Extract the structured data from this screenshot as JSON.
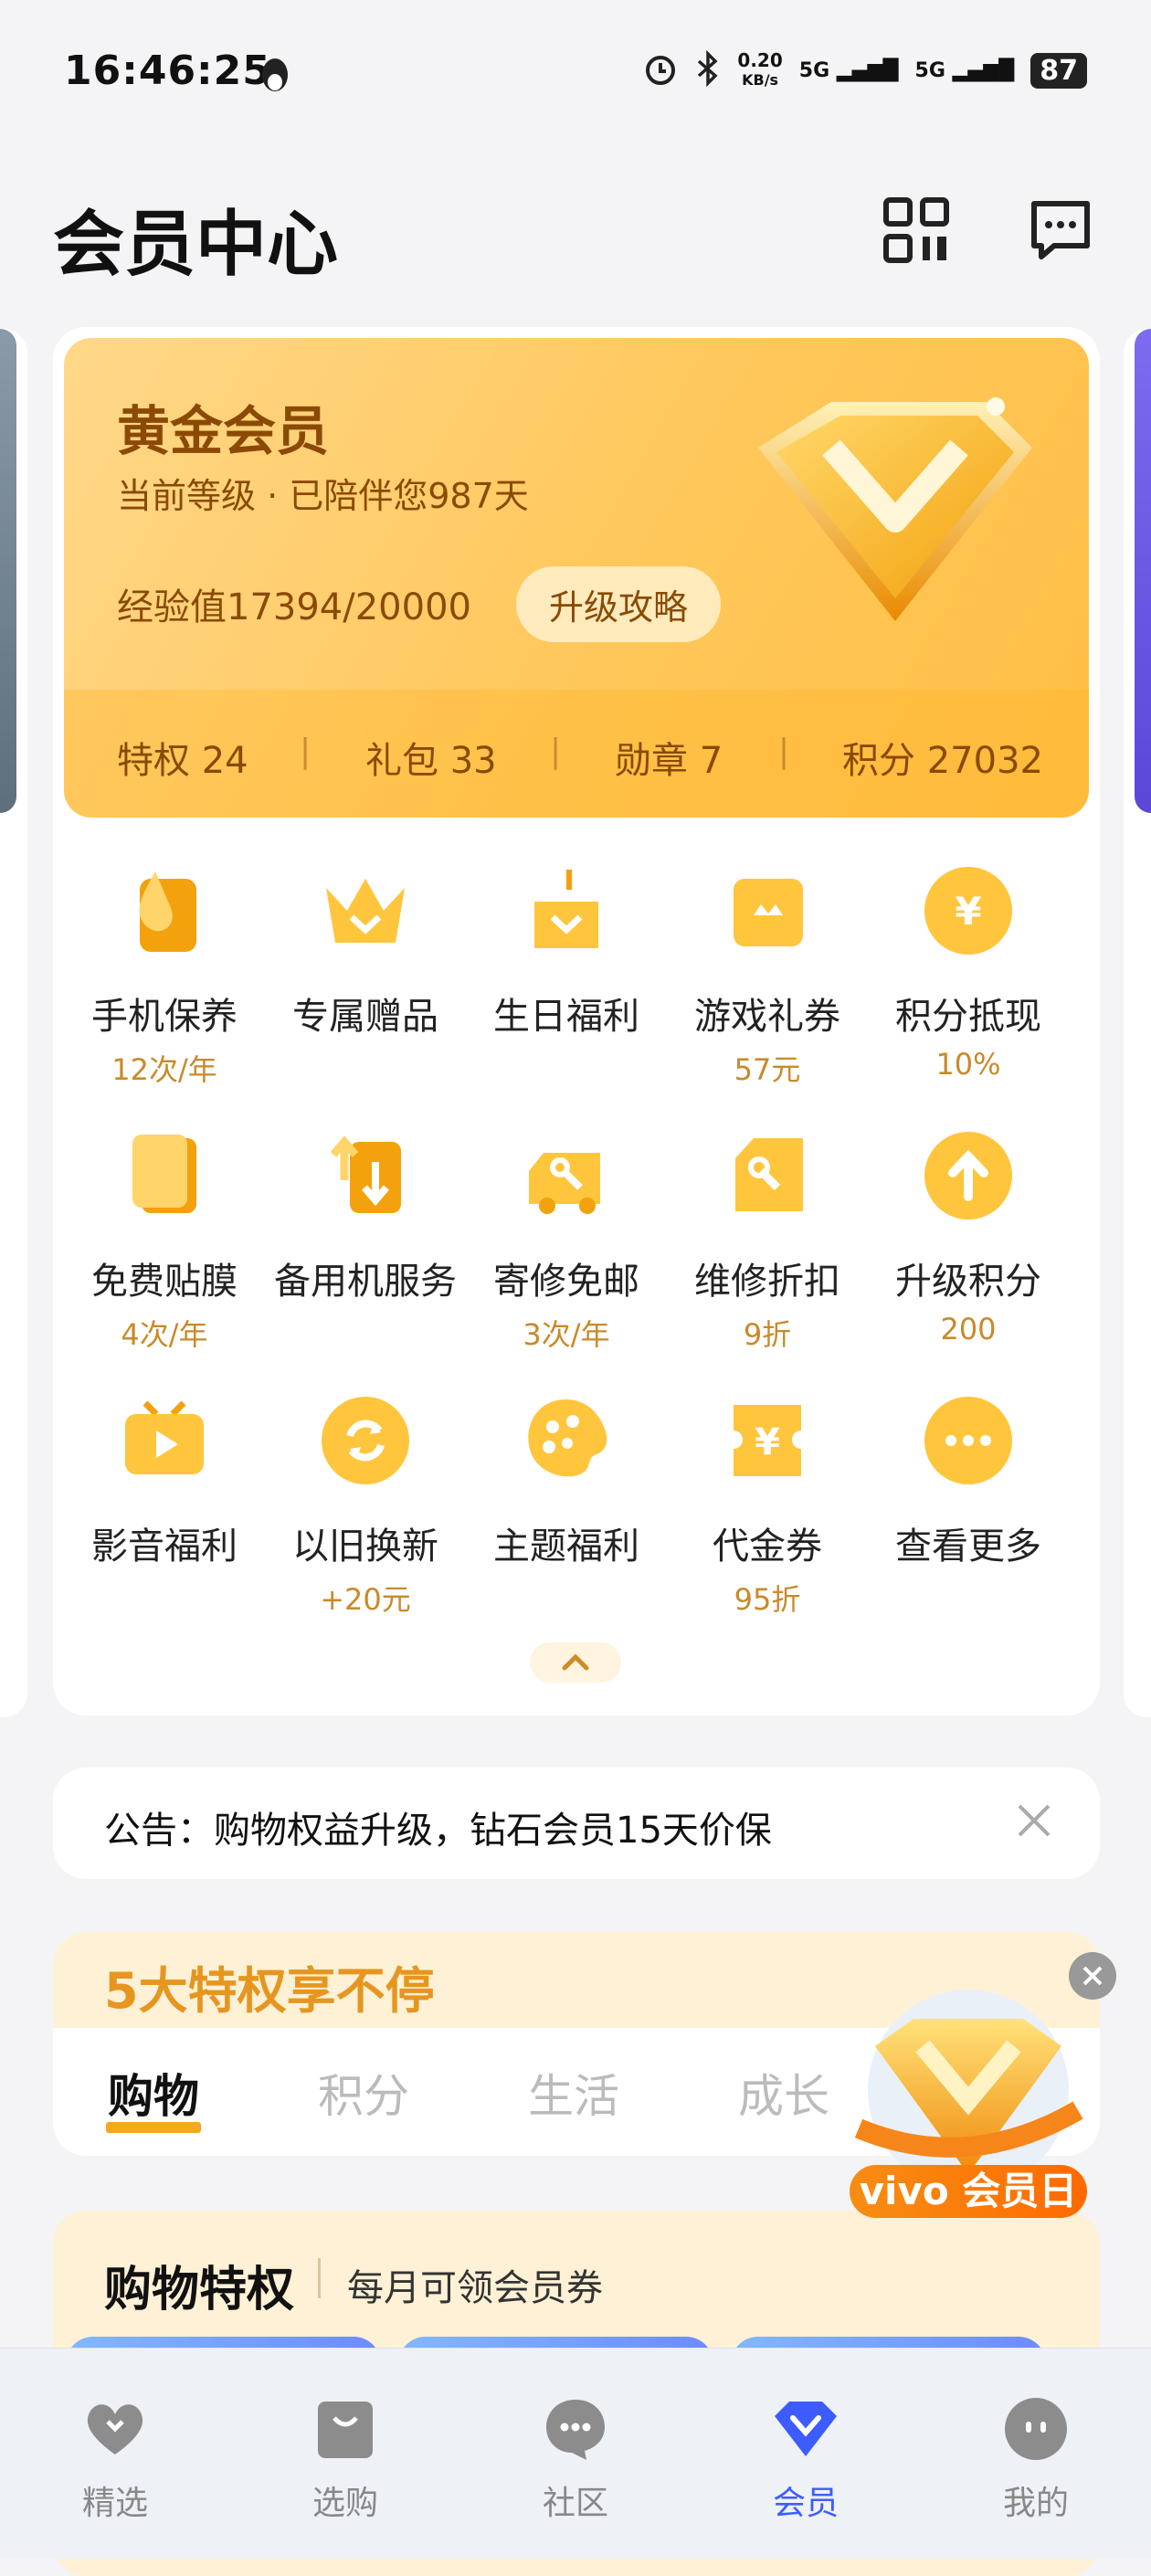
{
  "status_bar": {
    "time": "16:46:25",
    "net_speed_value": "0.20",
    "net_speed_unit": "KB/s",
    "signal_1": "5G",
    "signal_2": "5G",
    "battery": "87"
  },
  "header": {
    "title": "会员中心"
  },
  "member_card": {
    "tier": "黄金会员",
    "subtitle": "当前等级 · 已陪伴您987天",
    "exp_label": "经验值",
    "exp_value": "17394/20000",
    "upgrade_button": "升级攻略",
    "stats": [
      {
        "label": "特权",
        "value": "24"
      },
      {
        "label": "礼包",
        "value": "33"
      },
      {
        "label": "勋章",
        "value": "7"
      },
      {
        "label": "积分",
        "value": "27032"
      }
    ]
  },
  "benefits": [
    {
      "label": "手机保养",
      "sub": "12次/年",
      "icon": "droplet-icon"
    },
    {
      "label": "专属赠品",
      "sub": "",
      "icon": "crown-icon"
    },
    {
      "label": "生日福利",
      "sub": "",
      "icon": "cake-icon"
    },
    {
      "label": "游戏礼券",
      "sub": "57元",
      "icon": "game-ticket-icon"
    },
    {
      "label": "积分抵现",
      "sub": "10%",
      "icon": "yuan-coin-icon"
    },
    {
      "label": "免费贴膜",
      "sub": "4次/年",
      "icon": "screen-film-icon"
    },
    {
      "label": "备用机服务",
      "sub": "",
      "icon": "backup-phone-icon"
    },
    {
      "label": "寄修免邮",
      "sub": "3次/年",
      "icon": "repair-truck-icon"
    },
    {
      "label": "维修折扣",
      "sub": "9折",
      "icon": "wrench-tag-icon"
    },
    {
      "label": "升级积分",
      "sub": "200",
      "icon": "arrow-up-coin-icon"
    },
    {
      "label": "影音福利",
      "sub": "",
      "icon": "tv-play-icon"
    },
    {
      "label": "以旧换新",
      "sub": "+20元",
      "icon": "refresh-coin-icon"
    },
    {
      "label": "主题福利",
      "sub": "",
      "icon": "palette-icon"
    },
    {
      "label": "代金券",
      "sub": "95折",
      "icon": "voucher-icon"
    },
    {
      "label": "查看更多",
      "sub": "",
      "icon": "more-icon"
    }
  ],
  "notice": {
    "text": "公告：购物权益升级，钻石会员15天价保"
  },
  "privileges": {
    "title": "5大特权享不停",
    "tabs": [
      "购物",
      "积分",
      "生活",
      "成长"
    ],
    "active_tab": "购物"
  },
  "vivo_float": {
    "label": "vivo 会员日"
  },
  "shopping": {
    "title": "购物特权",
    "subtitle": "每月可领会员券"
  },
  "bottom_nav": [
    {
      "label": "精选",
      "icon": "heart-icon"
    },
    {
      "label": "选购",
      "icon": "shopping-bag-icon"
    },
    {
      "label": "社区",
      "icon": "chat-bubble-icon"
    },
    {
      "label": "会员",
      "icon": "member-v-icon"
    },
    {
      "label": "我的",
      "icon": "profile-face-icon"
    }
  ],
  "colors": {
    "gold": "#ffc75a",
    "gold_text": "#8a4a05",
    "accent_orange": "#f7a81b",
    "nav_active": "#3d5cff"
  }
}
